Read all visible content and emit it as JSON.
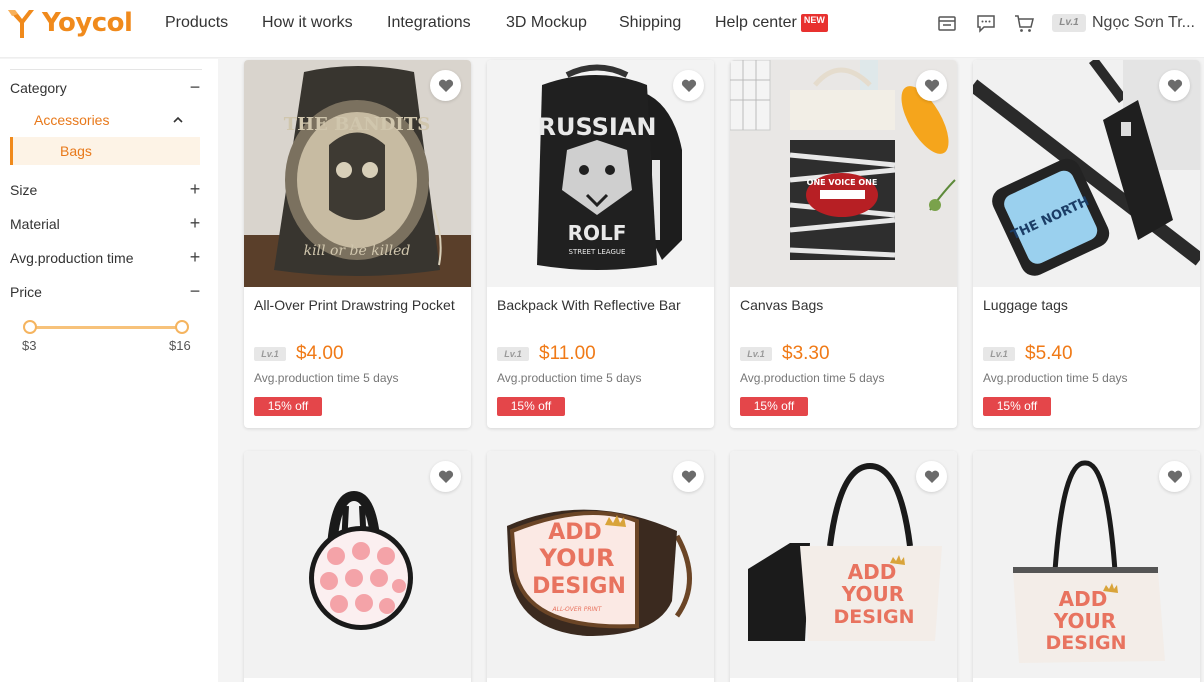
{
  "header": {
    "brand": "Yoycol",
    "nav": [
      "Products",
      "How it works",
      "Integrations",
      "3D Mockup",
      "Shipping",
      "Help center"
    ],
    "help_badge": "NEW",
    "icons": [
      "store-icon",
      "chat-icon",
      "cart-icon"
    ],
    "user_level": "Lv.1",
    "user_name": "Ngọc Sơn Tr..."
  },
  "sidebar": {
    "category_label": "Category",
    "category_toggle": "−",
    "accessories_label": "Accessories",
    "bags_label": "Bags",
    "filters": [
      {
        "label": "Size",
        "toggle": "+"
      },
      {
        "label": "Material",
        "toggle": "+"
      },
      {
        "label": "Avg.production time",
        "toggle": "+"
      },
      {
        "label": "Price",
        "toggle": "−"
      }
    ],
    "price_range": {
      "min_label": "$3",
      "max_label": "$16",
      "min_fraction": 0,
      "max_fraction": 1
    }
  },
  "products": [
    {
      "title": "All-Over Print Drawstring Pocket",
      "level": "Lv.1",
      "price": "$4.00",
      "production": "Avg.production time 5 days",
      "discount": "15% off"
    },
    {
      "title": "Backpack With Reflective Bar",
      "level": "Lv.1",
      "price": "$11.00",
      "production": "Avg.production time 5 days",
      "discount": "15% off"
    },
    {
      "title": "Canvas Bags",
      "level": "Lv.1",
      "price": "$3.30",
      "production": "Avg.production time 5 days",
      "discount": "15% off"
    },
    {
      "title": "Luggage tags",
      "level": "Lv.1",
      "price": "$5.40",
      "production": "Avg.production time 5 days",
      "discount": "15% off"
    }
  ],
  "product_images": {
    "drawstring": {
      "line1": "THE BANDITS",
      "line2": "kill or be killed"
    },
    "backpack": {
      "line1": "RUSSIAN",
      "line2": "ROLF",
      "line3": "STREET LEAGUE"
    },
    "canvas": {
      "line1": "ONE VOICE ONE"
    },
    "luggage": {
      "line1": "THE NORTH"
    },
    "design": {
      "line1": "ADD",
      "line2": "YOUR",
      "line3": "DESIGN",
      "line4": "ALL-OVER PRINT"
    }
  },
  "colors": {
    "brand": "#f08a1c",
    "price": "#f07a17",
    "discount": "#e4464a",
    "new_badge": "#e8312f"
  }
}
